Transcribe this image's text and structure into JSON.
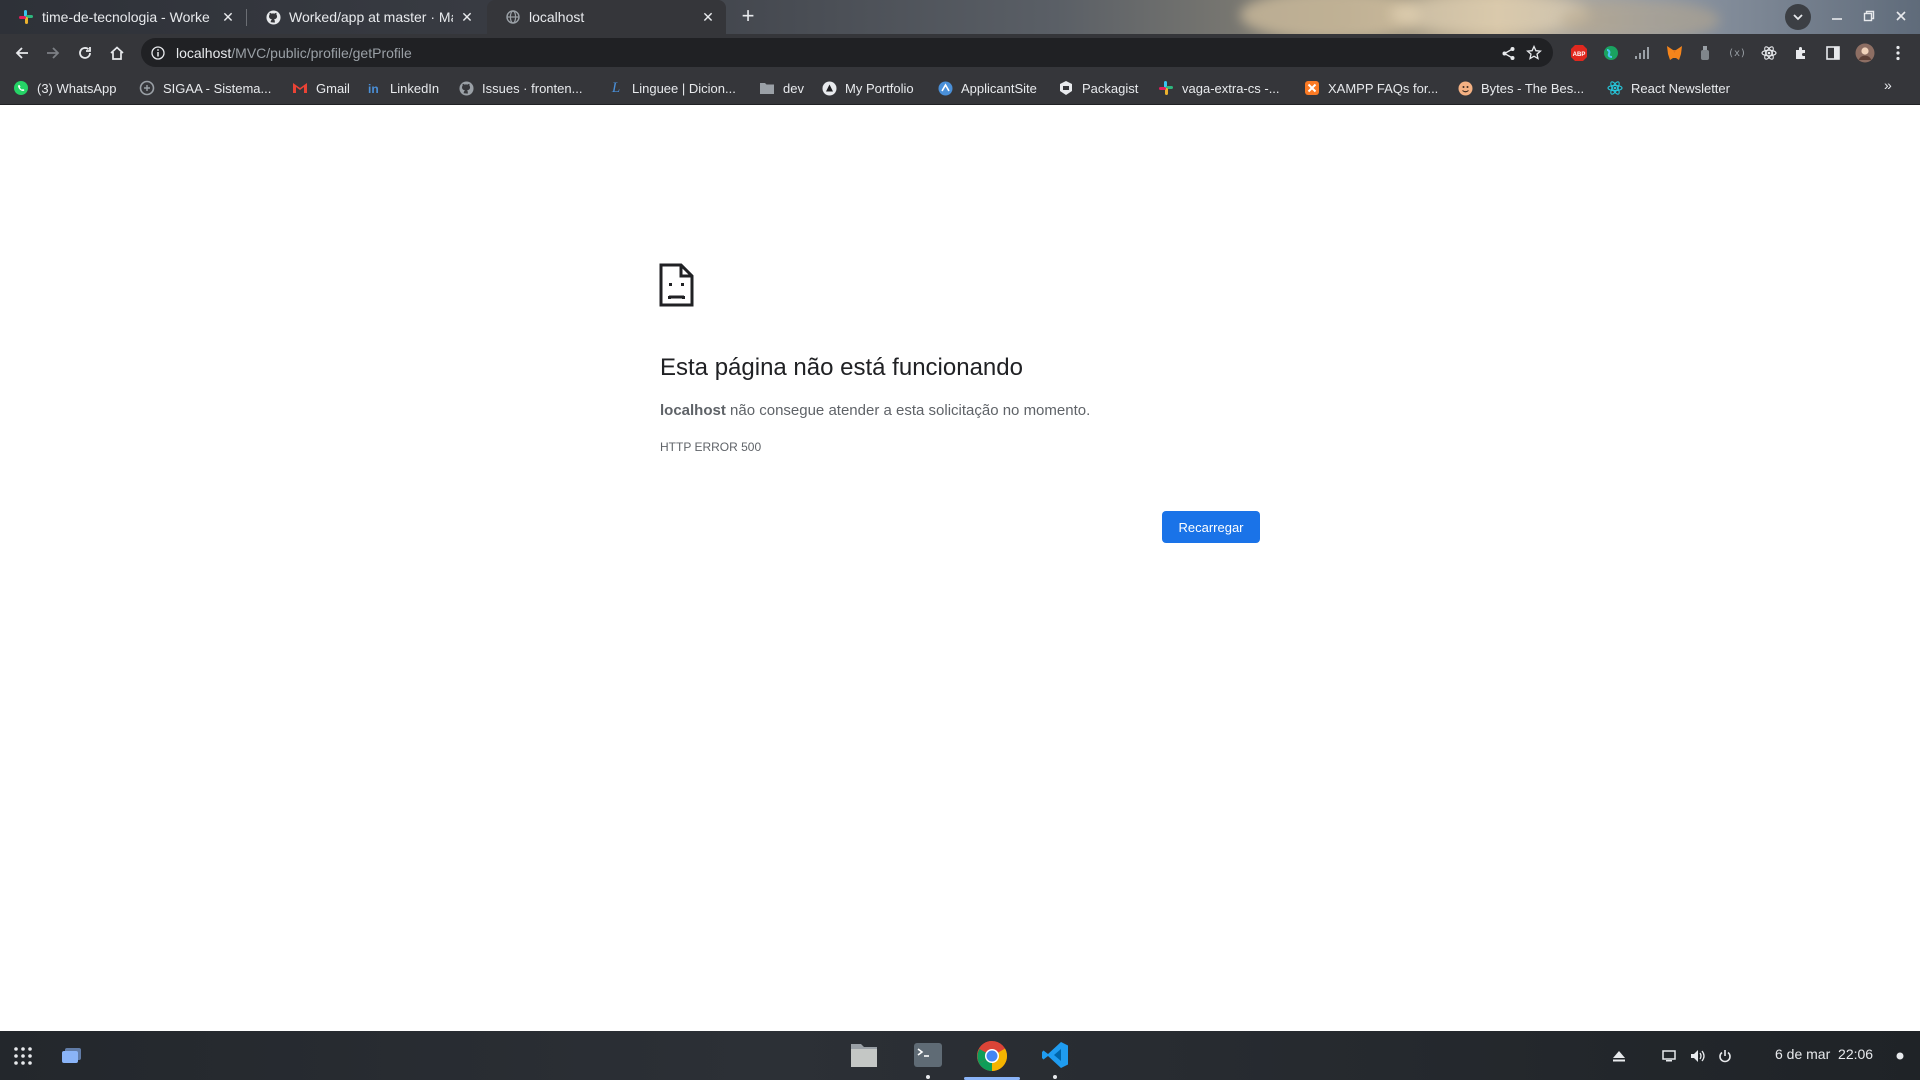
{
  "tabs": [
    {
      "title": "time-de-tecnologia - Worke",
      "favicon": "slack-icon",
      "active": false
    },
    {
      "title": "Worked/app at master · Ma",
      "favicon": "github-icon",
      "active": false
    },
    {
      "title": "localhost",
      "favicon": "globe-icon",
      "active": true
    }
  ],
  "toolbar": {
    "url_host": "localhost",
    "url_path": "/MVC/public/profile/getProfile"
  },
  "bookmarks": [
    {
      "label": "(3) WhatsApp",
      "icon": "whatsapp-icon"
    },
    {
      "label": "SIGAA - Sistema...",
      "icon": "sigaa-icon"
    },
    {
      "label": "Gmail",
      "icon": "gmail-icon"
    },
    {
      "label": "LinkedIn",
      "icon": "linkedin-icon"
    },
    {
      "label": "Issues · fronten...",
      "icon": "github-icon"
    },
    {
      "label": "Linguee | Dicion...",
      "icon": "linguee-icon"
    },
    {
      "label": "dev",
      "icon": "folder-icon"
    },
    {
      "label": "My Portfolio",
      "icon": "portfolio-icon"
    },
    {
      "label": "ApplicantSite",
      "icon": "applicantsite-icon"
    },
    {
      "label": "Packagist",
      "icon": "packagist-icon"
    },
    {
      "label": "vaga-extra-cs -...",
      "icon": "slack-icon"
    },
    {
      "label": "XAMPP FAQs for...",
      "icon": "xampp-icon"
    },
    {
      "label": "Bytes - The Bes...",
      "icon": "bytes-icon"
    },
    {
      "label": "React Newsletter",
      "icon": "react-icon"
    }
  ],
  "error_page": {
    "title": "Esta página não está funcionando",
    "host": "localhost",
    "description": " não consegue atender a esta solicitação no momento.",
    "code": "HTTP ERROR 500",
    "reload_label": "Recarregar"
  },
  "shelf": {
    "date": "6 de mar",
    "time": "22:06",
    "apps": [
      "files-icon",
      "terminal-icon",
      "chrome-icon",
      "vscode-icon"
    ]
  },
  "colors": {
    "accent": "#1a73e8",
    "toolbar": "#35363a",
    "omnibox": "#202124"
  }
}
